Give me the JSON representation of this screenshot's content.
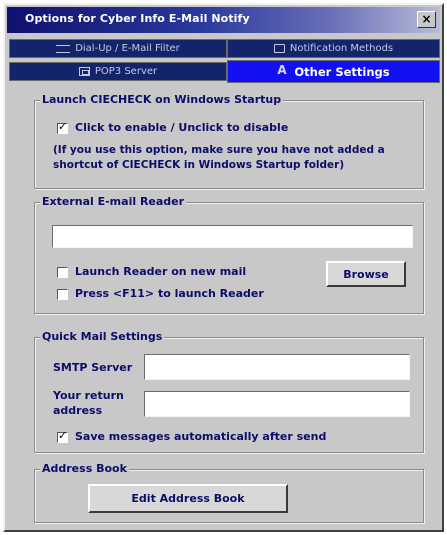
{
  "window": {
    "title": "Options for Cyber Info E-Mail Notify",
    "close_label": "×"
  },
  "tabs": [
    {
      "label": "Dial-Up / E-Mail Filter",
      "icon": "network-icon",
      "active": false
    },
    {
      "label": "Notification Methods",
      "icon": "computer-icon",
      "active": false
    },
    {
      "label": "POP3 Server",
      "icon": "server-icon",
      "active": false
    },
    {
      "label": "Other Settings",
      "icon": "alert-icon",
      "active": true
    }
  ],
  "launch_group": {
    "title": "Launch CIECHECK on Windows Startup",
    "checkbox_label": "Click to enable / Unclick to disable",
    "checked": true,
    "note_line1": "(If you use this option, make sure you have not added a",
    "note_line2": "shortcut of CIECHECK in Windows Startup folder)"
  },
  "reader_group": {
    "title": "External E-mail Reader",
    "path_value": "",
    "launch_on_new_mail_label": "Launch Reader on new mail",
    "launch_on_new_mail_checked": false,
    "f11_label": "Press <F11> to launch Reader",
    "f11_checked": false,
    "browse_label": "Browse"
  },
  "quickmail_group": {
    "title": "Quick Mail Settings",
    "smtp_label": "SMTP Server",
    "smtp_value": "",
    "return_label_line1": "Your return",
    "return_label_line2": "address",
    "return_value": "",
    "save_label": "Save messages automatically after send",
    "save_checked": true
  },
  "address_group": {
    "title": "Address Book",
    "edit_label": "Edit Address Book"
  },
  "colors": {
    "accent": "#1010f0",
    "tab_inactive": "#14246b",
    "text": "#0c0c6a",
    "face": "#c8c8c8"
  }
}
